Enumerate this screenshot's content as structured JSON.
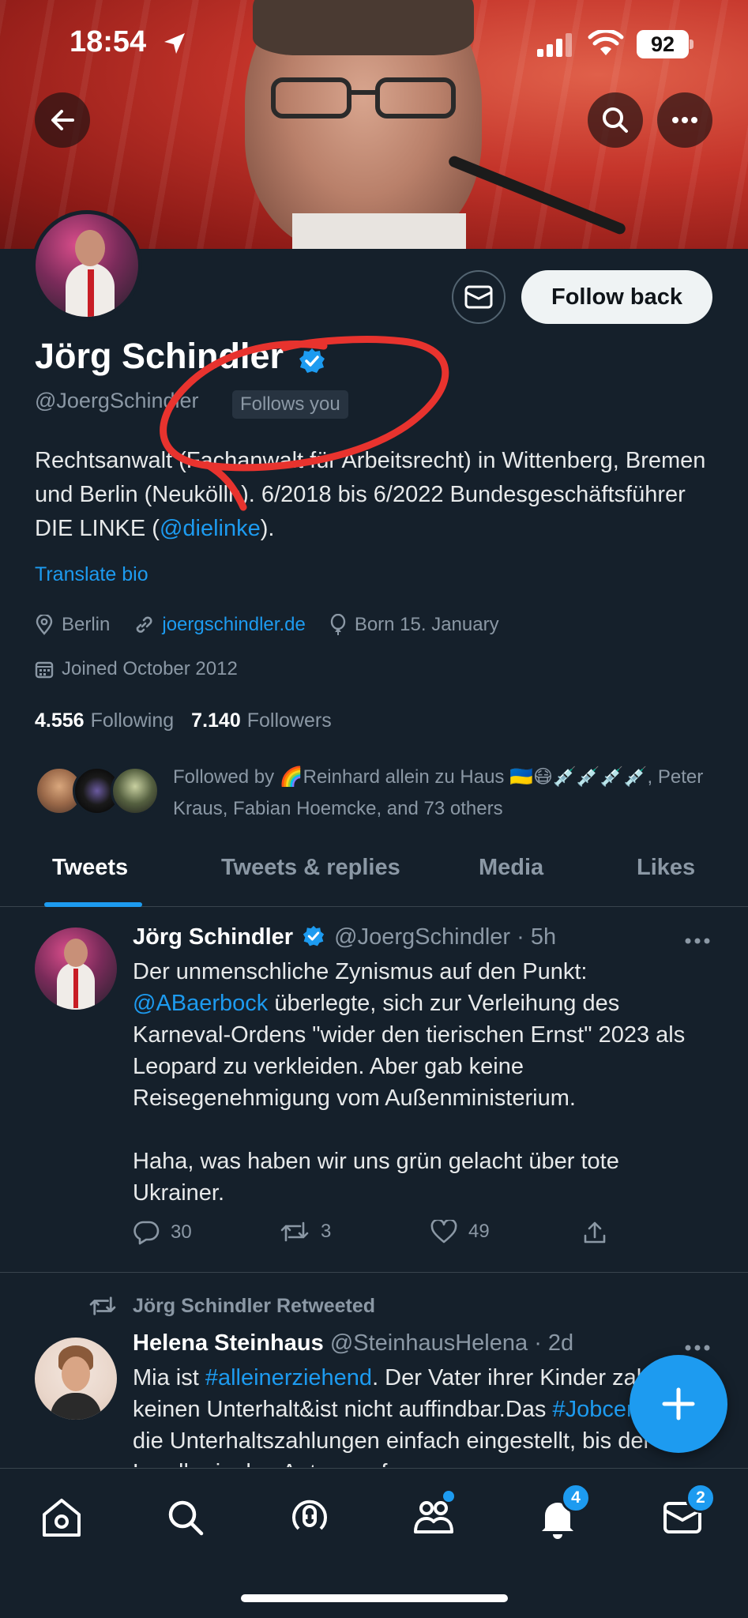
{
  "status_bar": {
    "time": "18:54",
    "battery": "92"
  },
  "profile": {
    "name": "Jörg Schindler",
    "handle": "@JoergSchindler",
    "follows_you": "Follows you",
    "follow_button": "Follow back",
    "bio_part1": "Rechtsanwalt (Fachanwalt für Arbeitsrecht) in Wittenberg, Bremen und Berlin (Neukölln). 6/2018 bis 6/2022 Bundesgeschäftsführer DIE LINKE (",
    "bio_mention": "@dielinke",
    "bio_part2": ").",
    "translate": "Translate bio",
    "location": "Berlin",
    "website": "joergschindler.de",
    "birthday": "Born 15. January",
    "joined": "Joined October 2012",
    "following_count": "4.556",
    "following_label": "Following",
    "followers_count": "7.140",
    "followers_label": "Followers",
    "followed_by": "Followed by 🌈Reinhard allein zu Haus 🇺🇦😷💉💉💉💉, Peter Kraus, Fabian Hoemcke, and 73 others"
  },
  "tabs": [
    {
      "label": "Tweets",
      "active": true
    },
    {
      "label": "Tweets & replies",
      "active": false
    },
    {
      "label": "Media",
      "active": false
    },
    {
      "label": "Likes",
      "active": false
    }
  ],
  "tweets": [
    {
      "name": "Jörg Schindler",
      "handle": "@JoergSchindler",
      "time": "· 5h",
      "text_line1": "Der unmenschliche Zynismus auf den Punkt:",
      "text_mention": "@ABaerbock",
      "text_rest": " überlegte, sich zur Verleihung des Karneval-Ordens \"wider den tierischen Ernst\" 2023 als Leopard zu verkleiden. Aber gab keine Reisegenehmigung vom Außenministerium.",
      "text_para2": "Haha, was haben wir uns grün gelacht über tote Ukrainer.",
      "replies": "30",
      "retweets": "3",
      "likes": "49"
    },
    {
      "retweeted_by": "Jörg Schindler Retweeted",
      "name": "Helena Steinhaus",
      "handle": "@SteinhausHelena",
      "time": "· 2d",
      "text_a": "Mia ist ",
      "text_tag1": "#alleinerziehend",
      "text_b": ". Der Vater ihrer Kinder zahlt keinen Unterhalt&ist nicht auffindbar.Das ",
      "text_tag2": "#Jobcenter",
      "text_c": " hat die Unterhaltszahlungen einfach eingestellt, bis der Landkreis den Antrag auf"
    }
  ],
  "nav": {
    "notifications_badge": "4",
    "messages_badge": "2"
  },
  "colors": {
    "background": "#15202b",
    "accent": "#1d9bf0",
    "annotation": "#e8332e"
  }
}
